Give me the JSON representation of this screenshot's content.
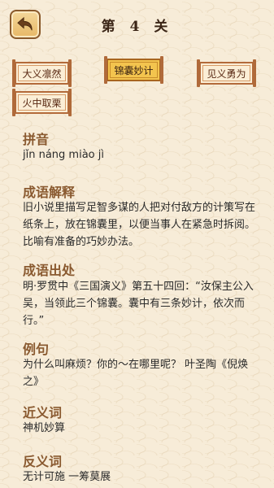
{
  "header": {
    "back_icon": "back-arrow-icon",
    "title": "第 4 关"
  },
  "options": [
    {
      "label": "大义凛然",
      "selected": false
    },
    {
      "label": "锦囊妙计",
      "selected": true
    },
    {
      "label": "见义勇为",
      "selected": false
    },
    {
      "label": "火中取栗",
      "selected": false
    }
  ],
  "sections": {
    "pinyin": {
      "title": "拼音",
      "text": "jǐn náng miào jì"
    },
    "meaning": {
      "title": "成语解释",
      "text": "旧小说里描写足智多谋的人把对付敌方的计策写在纸条上，放在锦囊里，以便当事人在紧急时拆阅。比喻有准备的巧妙办法。"
    },
    "source": {
      "title": "成语出处",
      "text": "明·罗贯中《三国演义》第五十四回：“汝保主公入吴，当领此三个锦囊。囊中有三条妙计，依次而行。”"
    },
    "example": {
      "title": "例句",
      "text": "为什么叫麻烦？你的～在哪里呢？ 叶圣陶《倪焕之》"
    },
    "synonym": {
      "title": "近义词",
      "text": "神机妙算"
    },
    "antonym": {
      "title": "反义词",
      "text": "无计可施 一筹莫展"
    }
  },
  "colors": {
    "background": "#f7ecd8",
    "section_title": "#8a5a30",
    "selected_option": "#f3c44e",
    "option_border": "#b36a3a"
  }
}
